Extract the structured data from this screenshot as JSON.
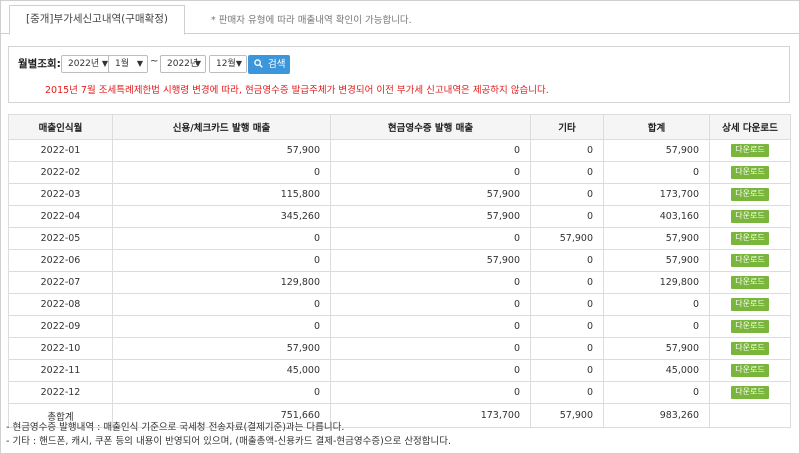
{
  "tabs": {
    "active_label": "[중개]부가세신고내역(구매확정)",
    "note": "* 판매자 유형에 따라 매출내역 확인이 가능합니다."
  },
  "search": {
    "label": "월별조회:",
    "from_year": "2022년",
    "from_month": "1월",
    "separator": "~",
    "to_year": "2022년",
    "to_month": "12월",
    "button": "검색",
    "warning": "2015년 7월 조세특례제한법 시행령 변경에 따라, 현금영수증 발급주체가 변경되어 이전 부가세 신고내역은 제공하지 않습니다."
  },
  "table": {
    "headers": [
      "매출인식월",
      "신용/체크카드 발행 매출",
      "현금영수증 발행 매출",
      "기타",
      "합계",
      "상세 다운로드"
    ],
    "download_label": "다운로드",
    "rows": [
      {
        "month": "2022-01",
        "card": "57,900",
        "cash": "0",
        "etc": "0",
        "sum": "57,900"
      },
      {
        "month": "2022-02",
        "card": "0",
        "cash": "0",
        "etc": "0",
        "sum": "0"
      },
      {
        "month": "2022-03",
        "card": "115,800",
        "cash": "57,900",
        "etc": "0",
        "sum": "173,700"
      },
      {
        "month": "2022-04",
        "card": "345,260",
        "cash": "57,900",
        "etc": "0",
        "sum": "403,160"
      },
      {
        "month": "2022-05",
        "card": "0",
        "cash": "0",
        "etc": "57,900",
        "sum": "57,900"
      },
      {
        "month": "2022-06",
        "card": "0",
        "cash": "57,900",
        "etc": "0",
        "sum": "57,900"
      },
      {
        "month": "2022-07",
        "card": "129,800",
        "cash": "0",
        "etc": "0",
        "sum": "129,800"
      },
      {
        "month": "2022-08",
        "card": "0",
        "cash": "0",
        "etc": "0",
        "sum": "0"
      },
      {
        "month": "2022-09",
        "card": "0",
        "cash": "0",
        "etc": "0",
        "sum": "0"
      },
      {
        "month": "2022-10",
        "card": "57,900",
        "cash": "0",
        "etc": "0",
        "sum": "57,900"
      },
      {
        "month": "2022-11",
        "card": "45,000",
        "cash": "0",
        "etc": "0",
        "sum": "45,000"
      },
      {
        "month": "2022-12",
        "card": "0",
        "cash": "0",
        "etc": "0",
        "sum": "0"
      }
    ],
    "total": {
      "label": "총합계",
      "card": "751,660",
      "cash": "173,700",
      "etc": "57,900",
      "sum": "983,260"
    }
  },
  "notes": [
    "- 현금영수증 발행내역 : 매출인식 기준으로 국세청 전송자료(결제기준)과는 다릅니다.",
    "- 기타 : 핸드폰, 캐시, 쿠폰 등의 내용이 반영되어 있으며, (매출총액-신용카드 결제-현금영수증)으로 산정합니다."
  ],
  "colors": {
    "search_button": "#3b96dc",
    "download_button": "#7ab63b",
    "warning": "#e21b1b"
  }
}
